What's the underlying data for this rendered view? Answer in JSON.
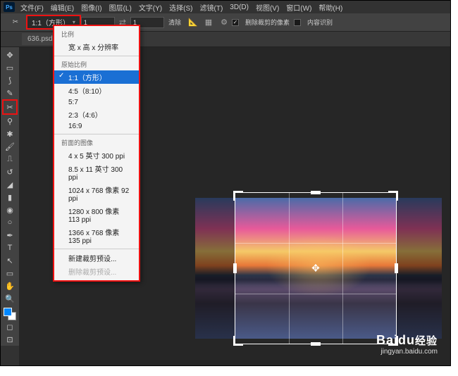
{
  "menu": {
    "file": "文件(F)",
    "edit": "编辑(E)",
    "image": "图像(I)",
    "layer": "图层(L)",
    "type": "文字(Y)",
    "select": "选择(S)",
    "filter": "滤镜(T)",
    "threed": "3D(D)",
    "view": "视图(V)",
    "window": "窗口(W)",
    "help": "帮助(H)"
  },
  "opt": {
    "ratio": "1:1（方形）",
    "field1": "1",
    "field2": "1",
    "clear": "清除",
    "delete_px": "删除裁剪的像素",
    "content_aware": "内容识别"
  },
  "tab": {
    "name": "636.psd",
    "close": "×"
  },
  "dd": {
    "sec1": {
      "hd": "比例",
      "i1": "宽 x 高 x 分辨率"
    },
    "sec2": {
      "hd": "原始比例",
      "i1": "1:1（方形）",
      "i2": "4:5（8:10）",
      "i3": "5:7",
      "i4": "2:3（4:6）",
      "i5": "16:9"
    },
    "sec3": {
      "hd": "前面的图像",
      "i1": "4 x 5 英寸 300 ppi",
      "i2": "8.5 x 11 英寸 300 ppi",
      "i3": "1024 x 768 像素 92 ppi",
      "i4": "1280 x 800 像素 113 ppi",
      "i5": "1366 x 768 像素 135 ppi"
    },
    "sec4": {
      "i1": "新建裁剪预设...",
      "i2": "删除裁剪预设..."
    }
  },
  "wm": {
    "brand": "Bai",
    "brand2": "du",
    "zh": "经验",
    "url": "jingyan.baidu.com"
  },
  "ps": "Ps"
}
